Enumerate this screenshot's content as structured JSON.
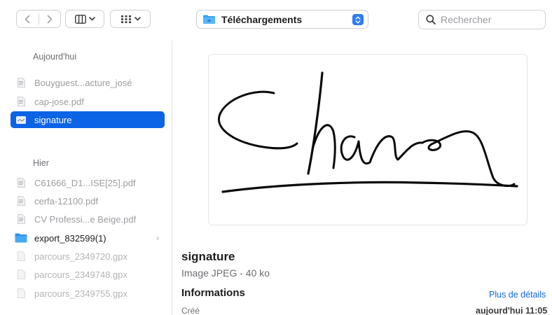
{
  "toolbar": {
    "location": "Téléchargements",
    "search_placeholder": "Rechercher"
  },
  "sidebar": {
    "sections": [
      {
        "title": "Aujourd'hui",
        "items": [
          {
            "label": "Bouyguest...acture_josé",
            "kind": "document"
          },
          {
            "label": "cap-jose.pdf",
            "kind": "document"
          },
          {
            "label": "signature",
            "kind": "image",
            "selected": true
          }
        ]
      },
      {
        "title": "Hier",
        "items": [
          {
            "label": "C61666_D1...ISE[25].pdf",
            "kind": "document"
          },
          {
            "label": "cerfa-12100.pdf",
            "kind": "document"
          },
          {
            "label": "CV Professi...e Beige.pdf",
            "kind": "document"
          },
          {
            "label": "export_832599(1)",
            "kind": "folder"
          },
          {
            "label": "parcours_2349720.gpx",
            "kind": "file"
          },
          {
            "label": "parcours_2349748.gpx",
            "kind": "file"
          },
          {
            "label": "parcours_2349755.gpx",
            "kind": "file"
          }
        ]
      }
    ]
  },
  "preview": {
    "name": "signature",
    "kind": "Image JPEG - 40 ko",
    "info_title": "Informations",
    "more_link": "Plus de détails",
    "created_label": "Créé",
    "created_value": "aujourd'hui 11:05"
  },
  "colors": {
    "accent": "#0b63e5",
    "link": "#1266e0",
    "folder": "#2e9bf0"
  }
}
